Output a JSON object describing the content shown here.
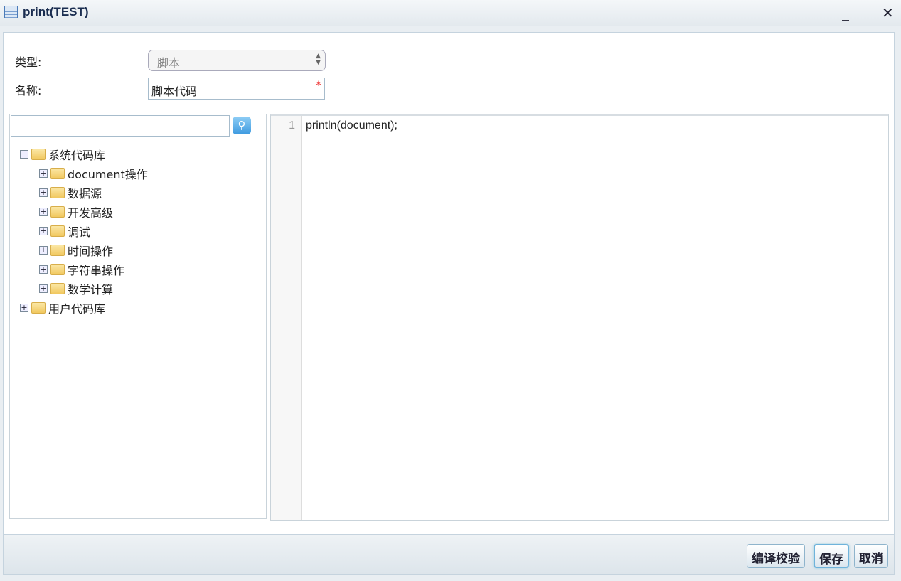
{
  "window": {
    "title": "print(TEST)",
    "minimize": "_",
    "close": "✕"
  },
  "form": {
    "type_label": "类型:",
    "type_value": "脚本",
    "name_label": "名称:",
    "name_value": "脚本代码",
    "required_mark": "*"
  },
  "tree": {
    "search_placeholder": "",
    "root1": "系统代码库",
    "children": [
      "document操作",
      "数据源",
      "开发高级",
      "调试",
      "时间操作",
      "字符串操作",
      "数学计算"
    ],
    "root2": "用户代码库"
  },
  "editor": {
    "line_number": "1",
    "code": "println(document);"
  },
  "footer": {
    "compile": "编译校验",
    "save": "保存",
    "cancel": "取消"
  }
}
